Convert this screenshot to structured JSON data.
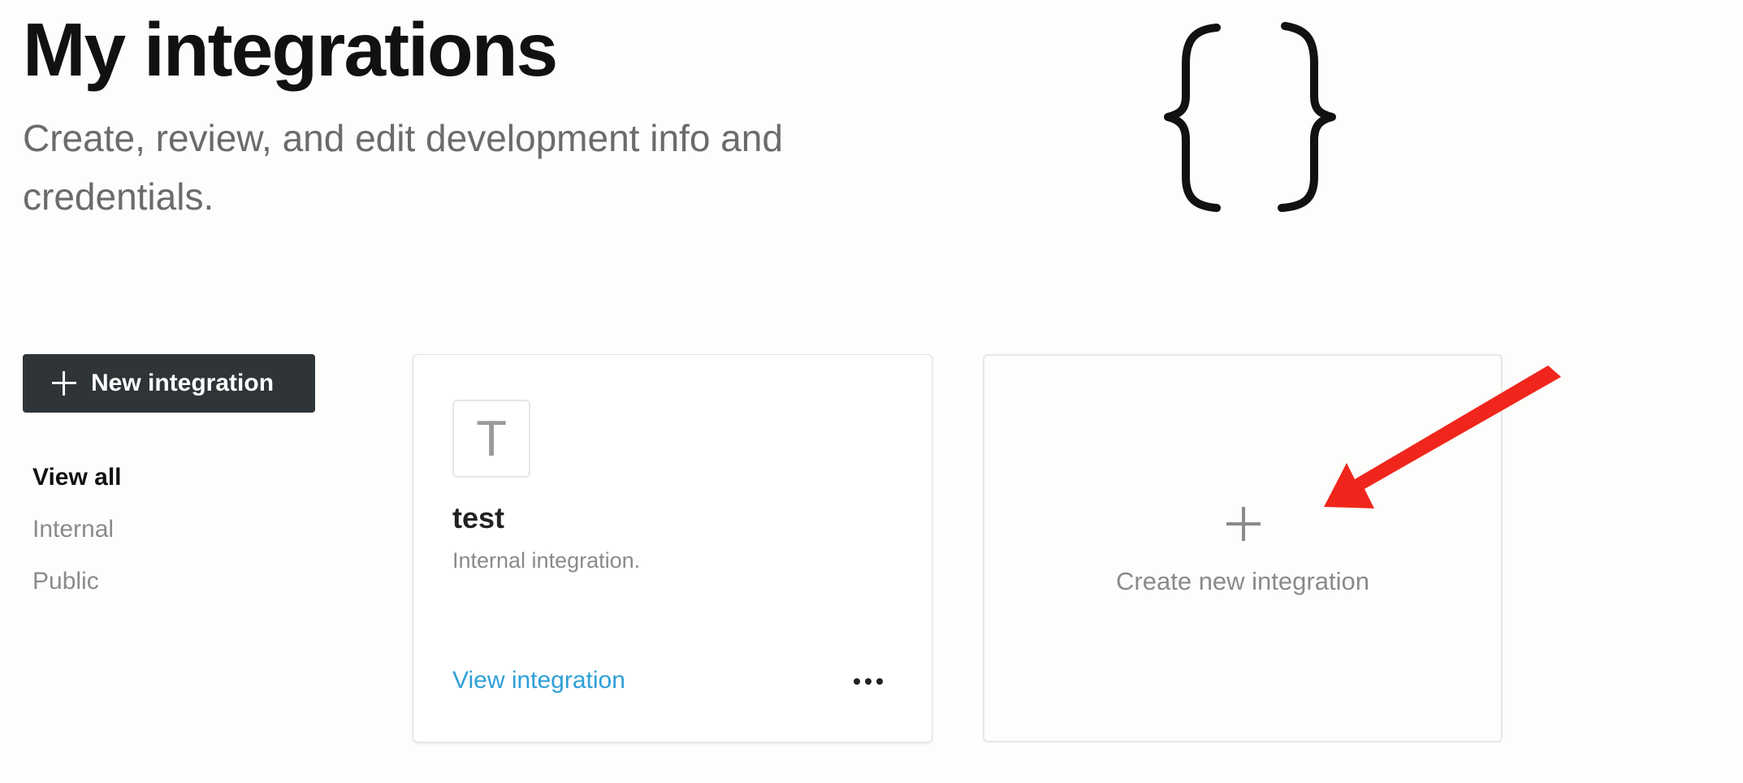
{
  "header": {
    "title": "My integrations",
    "subtitle": "Create, review, and edit development info and credentials."
  },
  "sidebar": {
    "new_button_label": "New integration",
    "filters": [
      {
        "label": "View all",
        "active": true
      },
      {
        "label": "Internal",
        "active": false
      },
      {
        "label": "Public",
        "active": false
      }
    ]
  },
  "integrations": [
    {
      "avatar_letter": "T",
      "name": "test",
      "description": "Internal integration.",
      "link_label": "View integration"
    }
  ],
  "create_card": {
    "label": "Create new integration"
  },
  "colors": {
    "primary_button": "#2f3437",
    "link": "#2e9fd8",
    "annotation_arrow": "#f0261c"
  },
  "icons": [
    "braces-icon",
    "plus-icon",
    "more-horizontal-icon",
    "arrow-annotation-icon"
  ]
}
